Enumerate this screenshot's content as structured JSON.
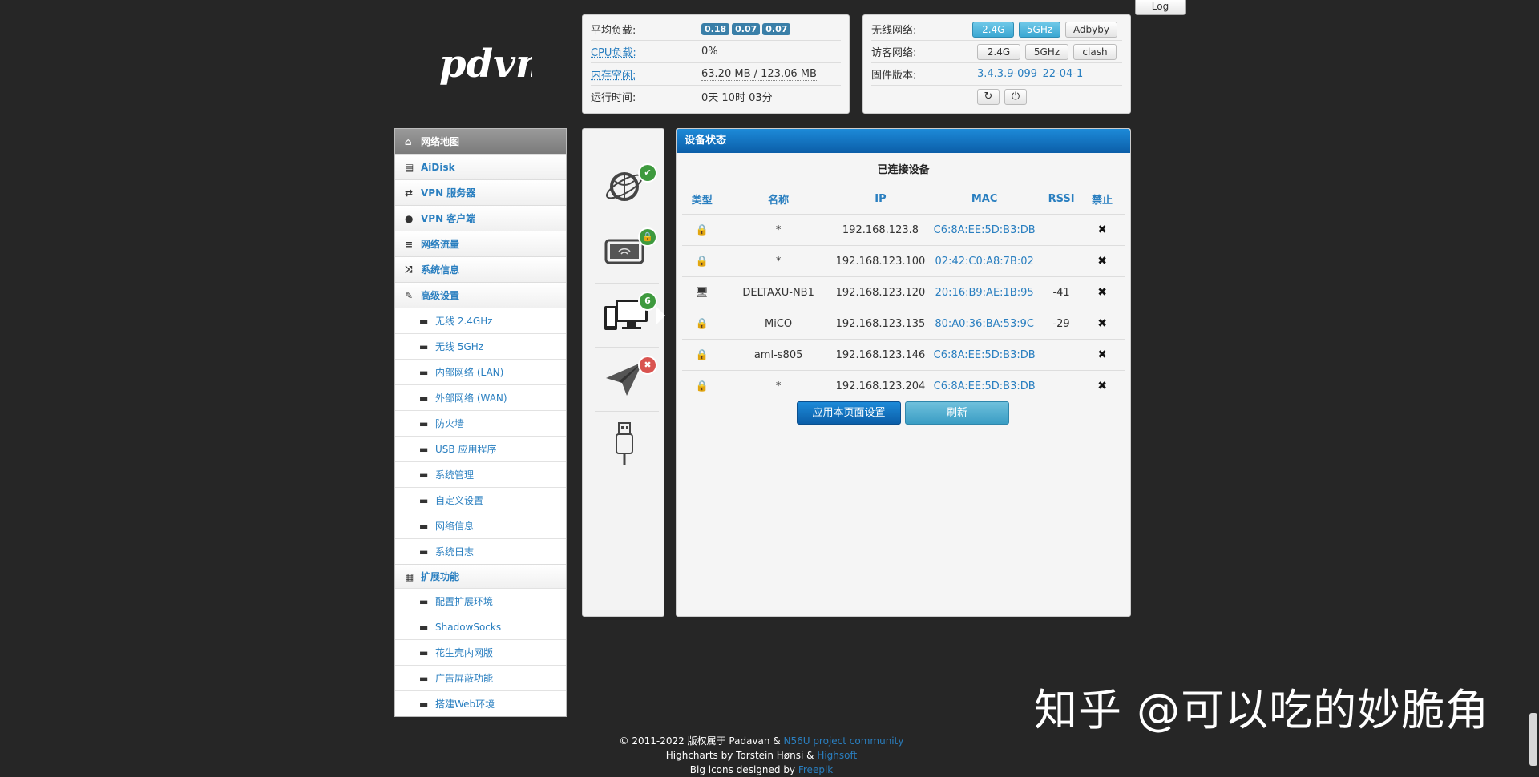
{
  "header": {
    "logo_text": "pdvn",
    "log_button": "Log"
  },
  "system_info": {
    "load_label": "平均负载:",
    "load_values": [
      "0.18",
      "0.07",
      "0.07"
    ],
    "cpu_label": "CPU负载:",
    "cpu_value": "0%",
    "mem_label": "内存空闲:",
    "mem_value": "63.20 MB / 123.06 MB",
    "uptime_label": "运行时间:",
    "uptime_value": "0天 10时 03分"
  },
  "network_info": {
    "wifi_label": "无线网络:",
    "wifi_buttons": [
      "2.4G",
      "5GHz",
      "Adbyby"
    ],
    "guest_label": "访客网络:",
    "guest_buttons": [
      "2.4G",
      "5GHz",
      "clash"
    ],
    "firmware_label": "固件版本:",
    "firmware_value": "3.4.3.9-099_22-04-1",
    "refresh_icon": "refresh-icon",
    "power_icon": "power-icon"
  },
  "sidebar": {
    "items": [
      {
        "label": "网络地图",
        "icon": "home-icon",
        "active": true
      },
      {
        "label": "AiDisk",
        "icon": "hdd-icon"
      },
      {
        "label": "VPN 服务器",
        "icon": "retweet-icon"
      },
      {
        "label": "VPN 客户端",
        "icon": "globe-icon"
      },
      {
        "label": "网络流量",
        "icon": "tasks-icon"
      },
      {
        "label": "系统信息",
        "icon": "random-icon"
      },
      {
        "label": "高级设置",
        "icon": "wrench-icon"
      }
    ],
    "advanced_sub": [
      "无线 2.4GHz",
      "无线 5GHz",
      "内部网络 (LAN)",
      "外部网络 (WAN)",
      "防火墙",
      "USB 应用程序",
      "系统管理",
      "自定义设置",
      "网络信息",
      "系统日志"
    ],
    "extension": {
      "label": "扩展功能",
      "icon": "grid-icon"
    },
    "extension_sub": [
      "配置扩展环境",
      "ShadowSocks",
      "花生壳内网版",
      "广告屏蔽功能",
      "搭建Web环境"
    ]
  },
  "device_icons": {
    "internet_badge": "✔",
    "router_badge": "lock",
    "clients_badge": "6",
    "vpn_badge": "✖"
  },
  "status_panel": {
    "title": "设备状态",
    "caption": "已连接设备",
    "columns": [
      "类型",
      "名称",
      "IP",
      "MAC",
      "RSSI",
      "禁止"
    ],
    "rows": [
      {
        "type": "lock-icon",
        "name": "*",
        "ip": "192.168.123.8",
        "mac": "C6:8A:EE:5D:B3:DB",
        "rssi": ""
      },
      {
        "type": "lock-icon",
        "name": "*",
        "ip": "192.168.123.100",
        "mac": "02:42:C0:A8:7B:02",
        "rssi": ""
      },
      {
        "type": "desktop-icon",
        "name": "DELTAXU-NB1",
        "ip": "192.168.123.120",
        "mac": "20:16:B9:AE:1B:95",
        "rssi": "-41"
      },
      {
        "type": "lock-icon",
        "name": "MiCO",
        "ip": "192.168.123.135",
        "mac": "80:A0:36:BA:53:9C",
        "rssi": "-29"
      },
      {
        "type": "lock-icon",
        "name": "aml-s805",
        "ip": "192.168.123.146",
        "mac": "C6:8A:EE:5D:B3:DB",
        "rssi": ""
      },
      {
        "type": "lock-icon",
        "name": "*",
        "ip": "192.168.123.204",
        "mac": "C6:8A:EE:5D:B3:DB",
        "rssi": ""
      }
    ],
    "apply_button": "应用本页面设置",
    "refresh_button": "刷新"
  },
  "footer": {
    "line1_text": "© 2011-2022 版权属于 Padavan & ",
    "line1_link": "N56U project community",
    "line2_text": "Highcharts by Torstein Hønsi & ",
    "line2_link": "Highsoft",
    "line3_text": "Big icons designed by ",
    "line3_link": "Freepik"
  },
  "watermark": "知乎 @可以吃的妙脆角",
  "colors": {
    "background": "#262626",
    "accent_blue": "#2a7fc0",
    "header_blue": "#0b5ea8",
    "badge_green": "#3e9a3e",
    "badge_red": "#d9534f"
  }
}
